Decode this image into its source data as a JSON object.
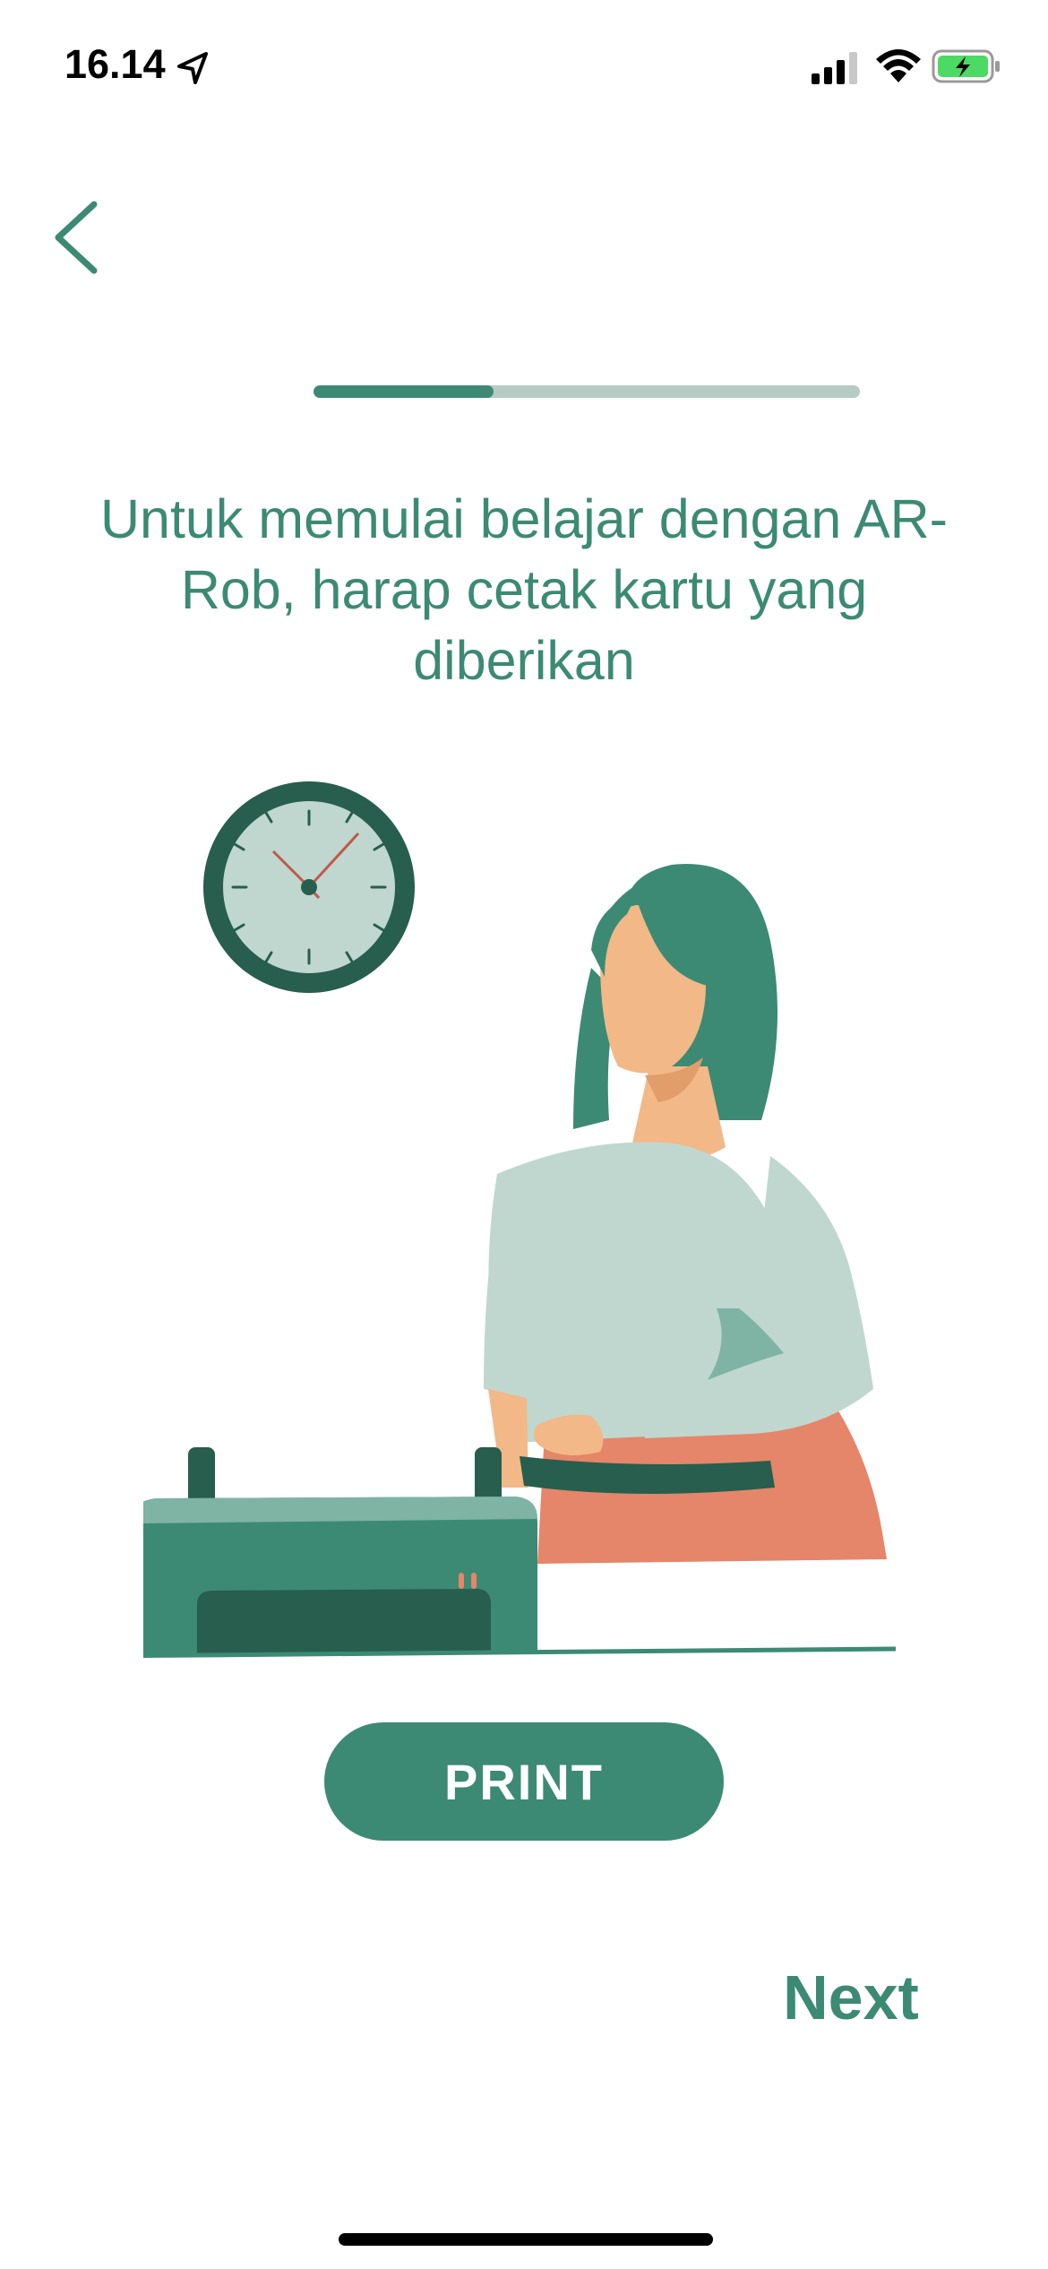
{
  "status_bar": {
    "time": "16.14",
    "location_icon": "location-arrow-icon",
    "signal_icon": "cellular-signal-icon",
    "wifi_icon": "wifi-icon",
    "battery_icon": "battery-charging-icon"
  },
  "nav": {
    "back_icon": "chevron-left-icon"
  },
  "progress": {
    "fraction": 0.33
  },
  "instruction": {
    "text": "Untuk memulai belajar dengan AR-Rob, harap cetak kartu yang diberikan"
  },
  "illustration": {
    "subject": "woman-at-printer-illustration",
    "clock_icon": "wall-clock-icon"
  },
  "actions": {
    "print_label": "PRINT",
    "next_label": "Next"
  },
  "colors": {
    "primary": "#3c8a73",
    "primary_dark": "#275e4d",
    "track": "#b6cbc3",
    "light_green": "#bfd7cf",
    "skin": "#f2b887",
    "skirt": "#e5856a"
  }
}
